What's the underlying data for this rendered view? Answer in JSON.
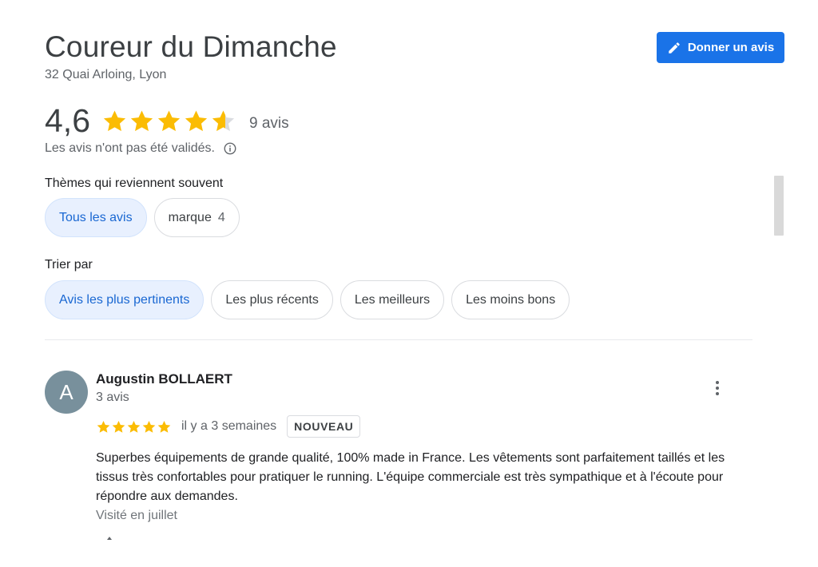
{
  "place": {
    "title": "Coureur du Dimanche",
    "address": "32 Quai Arloing, Lyon"
  },
  "write_review": {
    "label": "Donner un avis",
    "icon": "pencil-icon",
    "color": "#1a73e8"
  },
  "rating": {
    "average": "4,6",
    "stars": 4.6,
    "count_label": "9 avis",
    "star_color": "#fbbc04",
    "disclaimer": "Les avis n'ont pas été validés.",
    "info_icon": "info-icon"
  },
  "topics": {
    "label": "Thèmes qui reviennent souvent",
    "chips": [
      {
        "label": "Tous les avis",
        "count": "",
        "active": true
      },
      {
        "label": "marque",
        "count": "4",
        "active": false
      }
    ]
  },
  "sort": {
    "label": "Trier par",
    "chips": [
      {
        "label": "Avis les plus pertinents",
        "active": true
      },
      {
        "label": "Les plus récents",
        "active": false
      },
      {
        "label": "Les meilleurs",
        "active": false
      },
      {
        "label": "Les moins bons",
        "active": false
      }
    ]
  },
  "reviews": [
    {
      "avatar_letter": "A",
      "avatar_color": "#78909c",
      "name": "Augustin BOLLAERT",
      "reviewer_count": "3 avis",
      "stars": 5,
      "time": "il y a 3 semaines",
      "badge": "NOUVEAU",
      "text": "Superbes équipements de grande qualité, 100% made in France. Les vêtements sont parfaitement taillés et les tissus très confortables pour pratiquer le running. L'équipe commerciale est très sympathique et à l'écoute pour répondre aux demandes.",
      "visited": "Visité en juillet"
    }
  ]
}
